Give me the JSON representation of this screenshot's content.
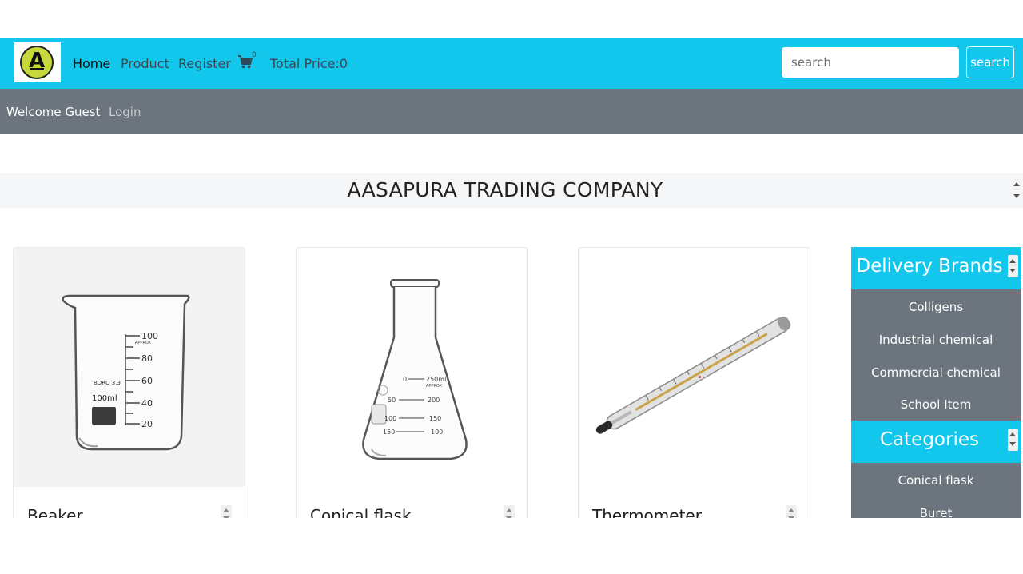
{
  "nav": {
    "logo_letter": "A",
    "links": [
      "Home",
      "Product",
      "Register"
    ],
    "cart_count": "0",
    "total_price": "Total Price:0",
    "search_placeholder": "search",
    "search_button": "search"
  },
  "welcome": {
    "greeting": "Welcome Guest",
    "login": "Login"
  },
  "banner": {
    "title": "AASAPURA TRADING COMPANY"
  },
  "products": [
    {
      "name": "Beaker",
      "image_icon": "beaker-icon"
    },
    {
      "name": "Conical flask",
      "image_icon": "conical-flask-icon"
    },
    {
      "name": "Thermometer",
      "image_icon": "thermometer-icon"
    }
  ],
  "sidebar": {
    "brands_title": "Delivery Brands",
    "brands": [
      "Colligens",
      "Industrial chemical",
      "Commercial chemical",
      "School Item"
    ],
    "categories_title": "Categories",
    "categories": [
      "Conical flask",
      "Buret"
    ]
  },
  "image_labels": {
    "beaker": {
      "marks": [
        "100",
        "80",
        "60",
        "40",
        "20"
      ],
      "approx": "APPROX",
      "boro": "BORO 3.3",
      "volume": "100ml"
    },
    "flask": {
      "left_marks": [
        "0",
        "50",
        "100",
        "150"
      ],
      "right_marks": [
        "250ml",
        "200",
        "150",
        "100"
      ],
      "approx": "APPROX"
    }
  },
  "colors": {
    "nav_bg": "#12c6ec",
    "welcome_bg": "#6c757d",
    "banner_bg": "#f5f6f7"
  }
}
